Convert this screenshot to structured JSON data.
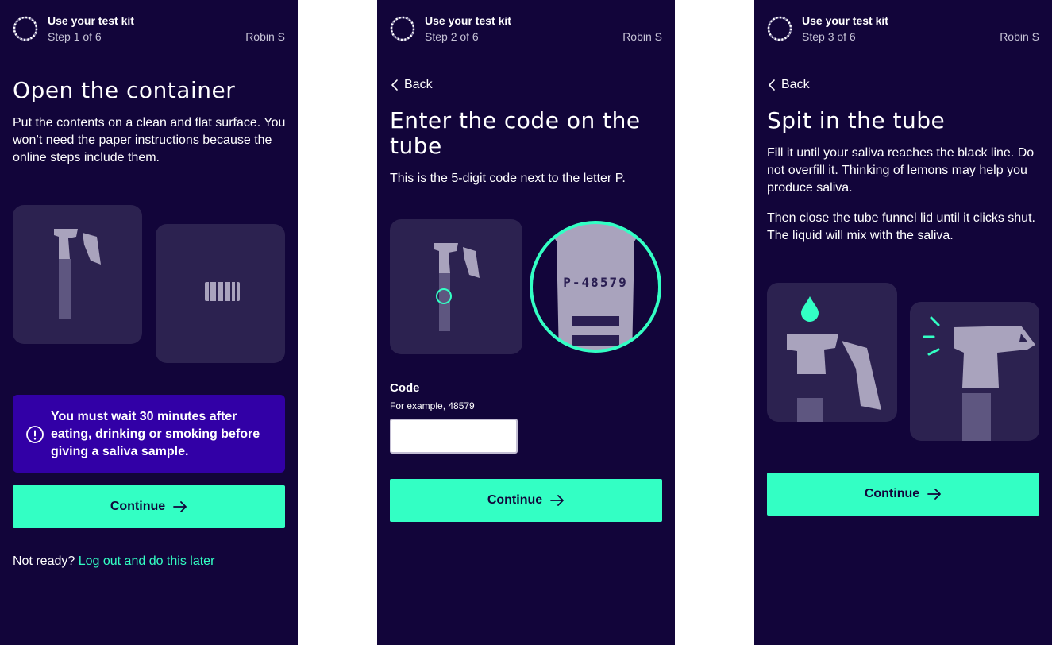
{
  "header": {
    "title": "Use your test kit",
    "user": "Robin S"
  },
  "screens": [
    {
      "step": "Step 1 of 6",
      "title": "Open the container",
      "body": "Put the contents on a clean and flat surface. You won’t need the paper instructions because the online steps include them.",
      "alert": "You must wait 30 minutes after eating, drinking or smoking before giving a saliva sample.",
      "continue_label": "Continue",
      "footer_prefix": "Not ready?",
      "footer_link": "Log out and do this later"
    },
    {
      "step": "Step 2 of 6",
      "back_label": "Back",
      "title": "Enter the code on the tube",
      "body": "This is the 5-digit code next to the letter P.",
      "tube_code": "P-48579",
      "field_label": "Code",
      "field_hint": "For example, 48579",
      "field_value": "",
      "continue_label": "Continue"
    },
    {
      "step": "Step 3 of 6",
      "back_label": "Back",
      "title": "Spit in the tube",
      "body1": "Fill it until your saliva reaches the black line. Do not overfill it. Thinking of lemons may help you produce saliva.",
      "body2": "Then close the tube funnel lid until it clicks shut. The liquid will mix with the saliva.",
      "continue_label": "Continue"
    }
  ],
  "colors": {
    "background": "#12053a",
    "tile": "#2c2250",
    "accent": "#33ffc4",
    "alert": "#3200a6",
    "illustration": "#a9a3bd"
  },
  "icons": {
    "progress": "progress-ring-icon",
    "back": "chevron-left-icon",
    "alert": "exclamation-circle-icon",
    "continue": "arrow-right-icon"
  }
}
